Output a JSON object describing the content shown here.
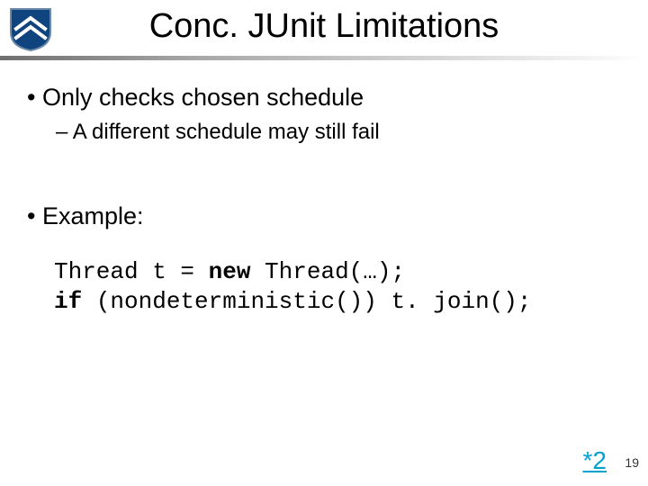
{
  "title": "Conc. JUnit Limitations",
  "bullets": {
    "b1a": "Only checks chosen schedule",
    "b2a": "A different schedule may still fail",
    "b1b": "Example:"
  },
  "code": {
    "line1_pre": "Thread t = ",
    "line1_kw": "new",
    "line1_post": " Thread(…);",
    "line2_kw": "if",
    "line2_post": " (nondeterministic()) t. join();"
  },
  "footnote": "*2",
  "pagenum": "19",
  "logo": {
    "name": "rice-shield-icon"
  }
}
